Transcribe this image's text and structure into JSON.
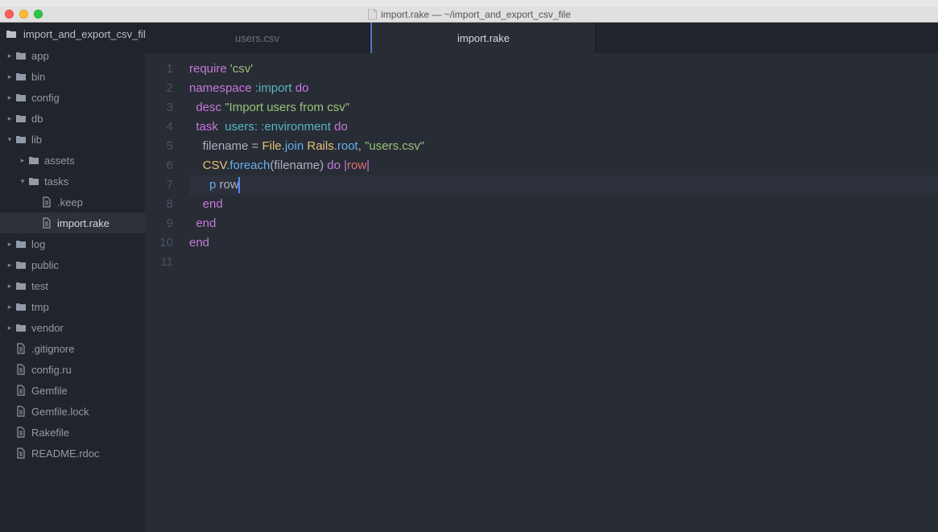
{
  "titlebar": {
    "filename": "import.rake — ~/import_and_export_csv_file"
  },
  "project_name": "import_and_export_csv_fil",
  "tree": [
    {
      "depth": 0,
      "type": "folder",
      "name": "app",
      "expanded": false
    },
    {
      "depth": 0,
      "type": "folder",
      "name": "bin",
      "expanded": false
    },
    {
      "depth": 0,
      "type": "folder",
      "name": "config",
      "expanded": false
    },
    {
      "depth": 0,
      "type": "folder",
      "name": "db",
      "expanded": false
    },
    {
      "depth": 0,
      "type": "folder",
      "name": "lib",
      "expanded": true
    },
    {
      "depth": 1,
      "type": "folder",
      "name": "assets",
      "expanded": false
    },
    {
      "depth": 1,
      "type": "folder",
      "name": "tasks",
      "expanded": true
    },
    {
      "depth": 2,
      "type": "file",
      "name": ".keep",
      "expanded": false
    },
    {
      "depth": 2,
      "type": "file",
      "name": "import.rake",
      "expanded": false,
      "active": true
    },
    {
      "depth": 0,
      "type": "folder",
      "name": "log",
      "expanded": false
    },
    {
      "depth": 0,
      "type": "folder",
      "name": "public",
      "expanded": false
    },
    {
      "depth": 0,
      "type": "folder",
      "name": "test",
      "expanded": false
    },
    {
      "depth": 0,
      "type": "folder",
      "name": "tmp",
      "expanded": false
    },
    {
      "depth": 0,
      "type": "folder",
      "name": "vendor",
      "expanded": false
    },
    {
      "depth": 0,
      "type": "file",
      "name": ".gitignore",
      "expanded": false
    },
    {
      "depth": 0,
      "type": "file",
      "name": "config.ru",
      "expanded": false
    },
    {
      "depth": 0,
      "type": "file",
      "name": "Gemfile",
      "expanded": false
    },
    {
      "depth": 0,
      "type": "file",
      "name": "Gemfile.lock",
      "expanded": false
    },
    {
      "depth": 0,
      "type": "file",
      "name": "Rakefile",
      "expanded": false
    },
    {
      "depth": 0,
      "type": "file",
      "name": "README.rdoc",
      "expanded": false
    }
  ],
  "tabs": [
    {
      "label": "users.csv",
      "active": false
    },
    {
      "label": "import.rake",
      "active": true
    }
  ],
  "line_numbers": [
    "1",
    "2",
    "3",
    "4",
    "5",
    "6",
    "7",
    "8",
    "9",
    "10",
    "11"
  ],
  "code": {
    "l1": {
      "require": "require",
      "space": " ",
      "str": "'csv'"
    },
    "l2": {
      "namespace": "namespace",
      "sym": ":import",
      "do": "do"
    },
    "l3": {
      "desc": "desc",
      "str": "\"Import users from csv\""
    },
    "l4": {
      "task": "task",
      "users": "users:",
      "env": ":environment",
      "do": "do"
    },
    "l5": {
      "filename": "filename",
      "eq": " = ",
      "File": "File",
      "dot1": ".",
      "join": "join",
      "sp": " ",
      "Rails": "Rails",
      "dot2": ".",
      "root": "root",
      "comma": ", ",
      "str": "\"users.csv\""
    },
    "l6": {
      "CSV": "CSV",
      "dot": ".",
      "foreach": "foreach",
      "open": "(",
      "filename": "filename",
      "close": ")",
      "do": "do",
      "pipe1": " |",
      "row": "row",
      "pipe2": "|"
    },
    "l7": {
      "p": "p",
      "row": "row"
    },
    "l8": {
      "end": "end"
    },
    "l9": {
      "end": "end"
    },
    "l10": {
      "end": "end"
    }
  }
}
